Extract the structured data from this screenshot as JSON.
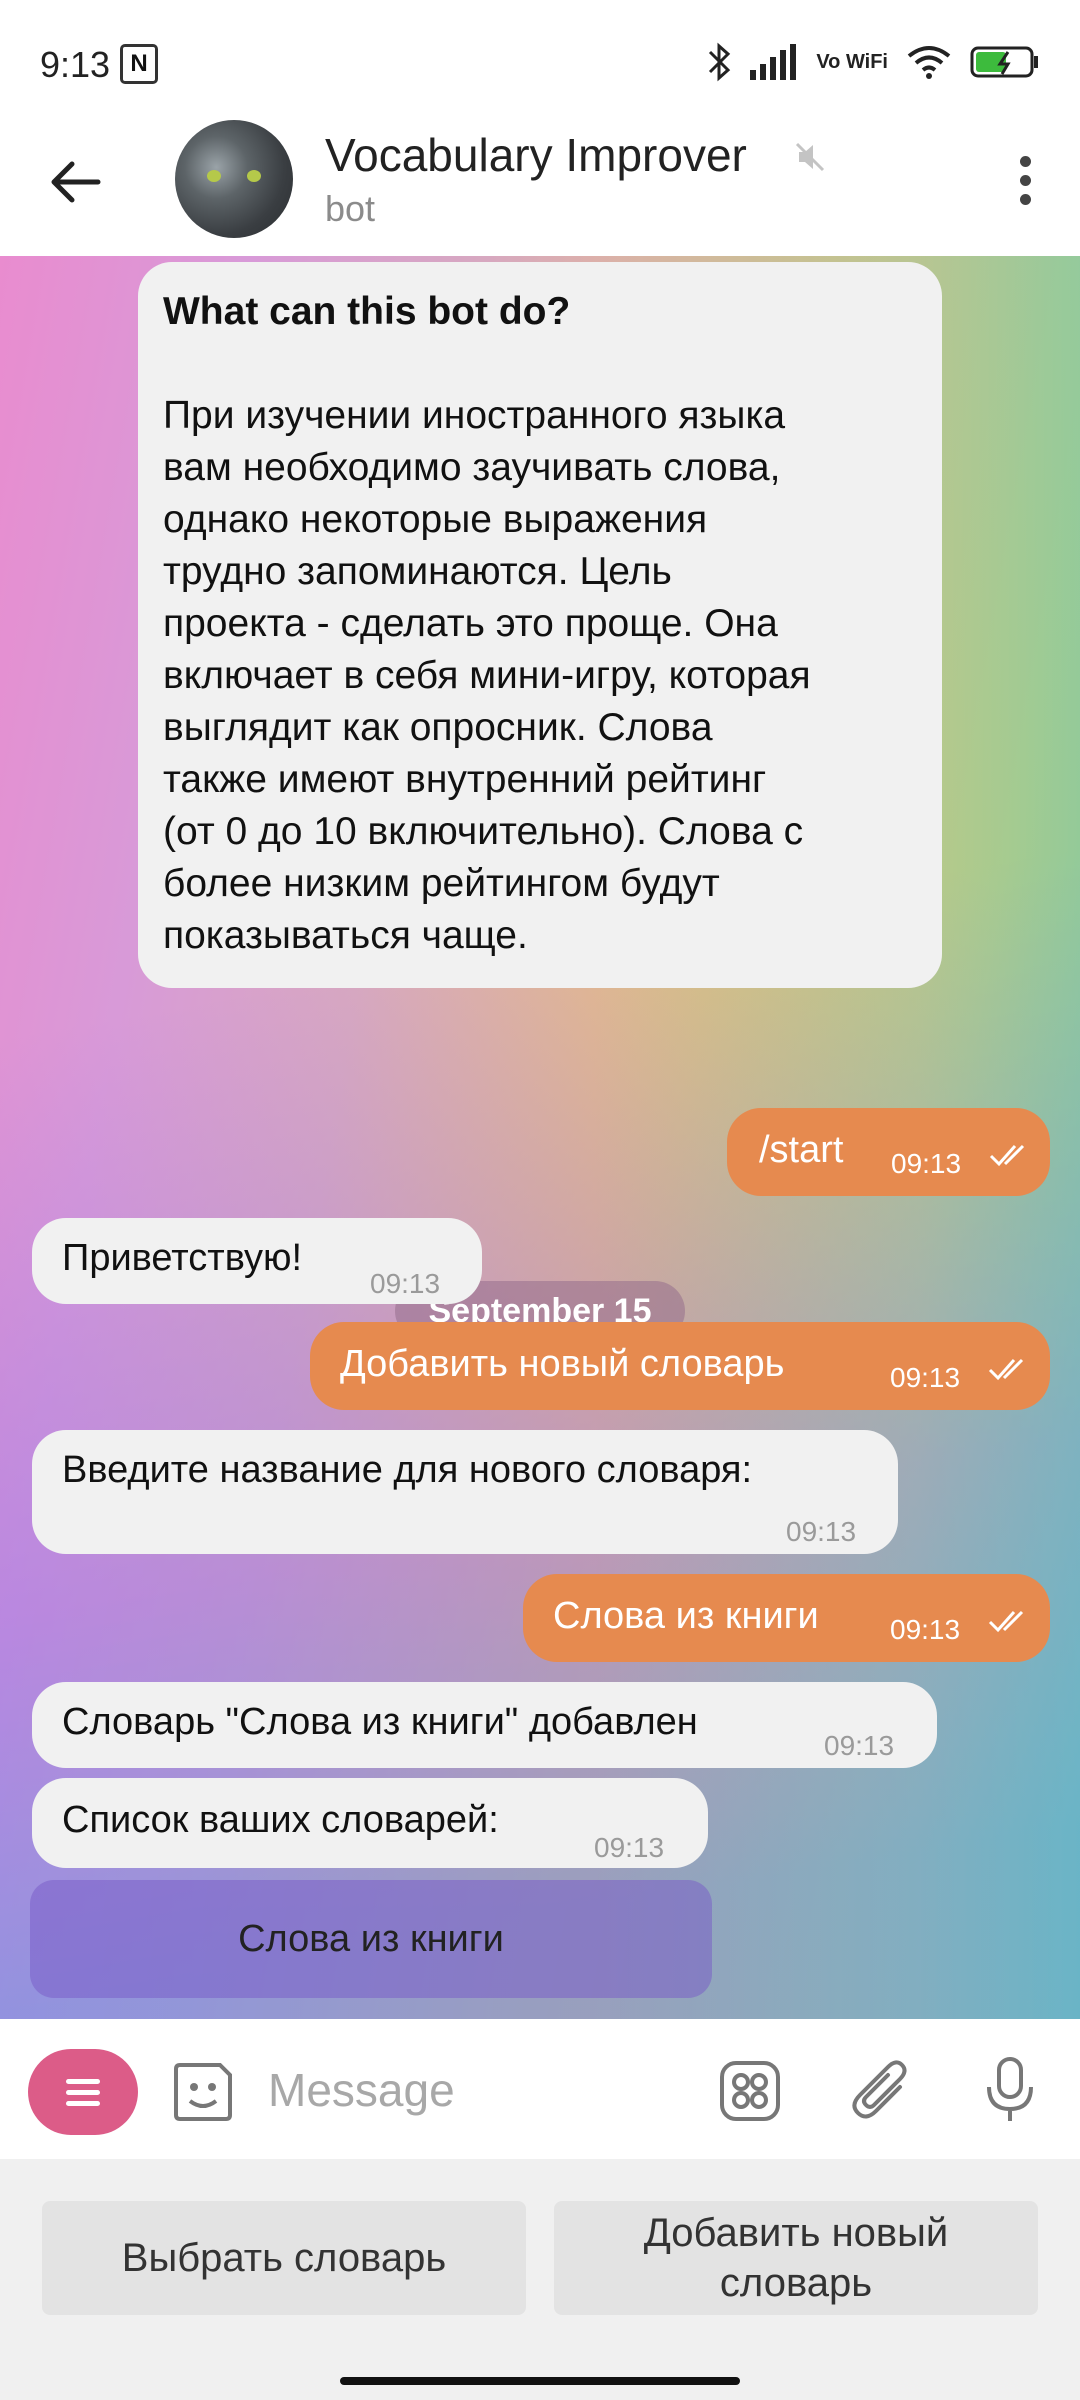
{
  "status_bar": {
    "time": "9:13",
    "vowifi": "Vo WiFi"
  },
  "header": {
    "title": "Vocabulary Improver",
    "subtitle": "bot"
  },
  "intro": {
    "heading": "What can this bot do?",
    "lines": [
      "При изучении иностранного языка",
      "вам необходимо заучивать слова,",
      "однако некоторые выражения",
      "трудно запоминаются. Цель",
      "проекта - сделать это проще. Она",
      "включает в себя мини-игру, которая",
      "выглядит как опросник. Слова",
      "также имеют внутренний рейтинг",
      "(от 0 до 10 включительно). Слова с",
      "более низким рейтингом будут",
      "показываться чаще."
    ]
  },
  "date_badge": "September 15",
  "messages": [
    {
      "text": "/start",
      "time": "09:13"
    },
    {
      "text": "Приветствую!",
      "time": "09:13"
    },
    {
      "text": "Добавить новый словарь",
      "time": "09:13"
    },
    {
      "text": "Введите название для нового словаря:",
      "time": "09:13"
    },
    {
      "text": "Слова из книги",
      "time": "09:13"
    },
    {
      "text": "Словарь \"Слова из книги\" добавлен",
      "time": "09:13"
    },
    {
      "text": "Список ваших словарей:",
      "time": "09:13"
    }
  ],
  "inline_button": "Слова из книги",
  "input": {
    "placeholder": "Message"
  },
  "reply_keyboard": {
    "left": "Выбрать словарь",
    "right_line1": "Добавить новый",
    "right_line2": "словарь"
  }
}
